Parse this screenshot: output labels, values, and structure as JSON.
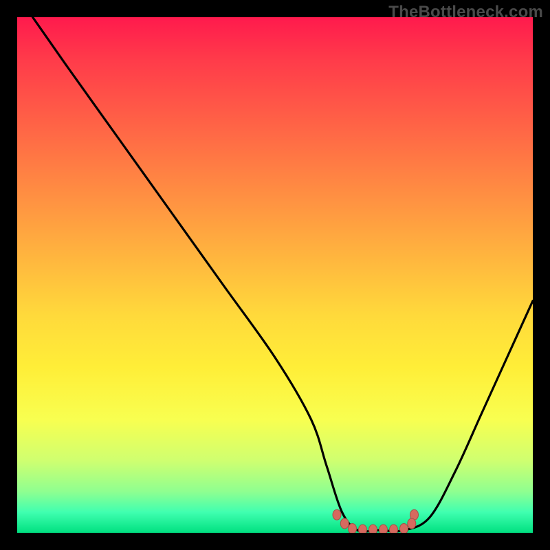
{
  "watermark": "TheBottleneck.com",
  "colors": {
    "background": "#000000",
    "curve": "#000000",
    "marker_fill": "#d66a5f",
    "marker_stroke": "#a84f46"
  },
  "chart_data": {
    "type": "line",
    "title": "",
    "xlabel": "",
    "ylabel": "",
    "xlim": [
      0,
      100
    ],
    "ylim": [
      0,
      100
    ],
    "grid": false,
    "series": [
      {
        "name": "bottleneck-curve",
        "x": [
          3,
          10,
          20,
          30,
          40,
          50,
          57,
          60,
          63,
          66,
          70,
          75,
          80,
          85,
          90,
          95,
          100
        ],
        "y": [
          100,
          90,
          76,
          62,
          48,
          34,
          22,
          13,
          4,
          0.5,
          0.5,
          0.5,
          3,
          12,
          23,
          34,
          45
        ]
      }
    ],
    "markers": {
      "x": [
        62,
        65,
        67,
        69,
        71,
        73,
        75,
        77,
        63.5,
        76.5
      ],
      "y": [
        3.5,
        0.8,
        0.6,
        0.6,
        0.6,
        0.6,
        0.8,
        3.5,
        1.8,
        1.8
      ]
    }
  }
}
